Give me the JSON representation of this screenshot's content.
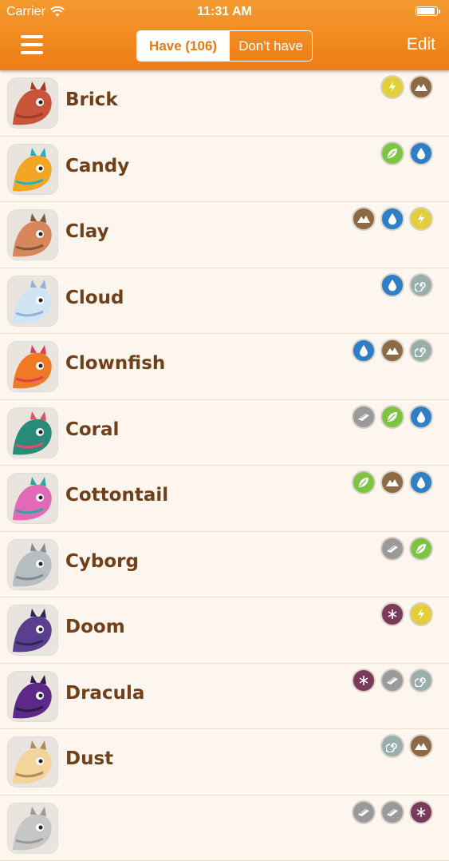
{
  "status": {
    "carrier": "Carrier",
    "time": "11:31 AM"
  },
  "nav": {
    "have_label": "Have (106)",
    "dont_have_label": "Don't have",
    "edit_label": "Edit"
  },
  "element_colors": {
    "lightning": "#e3cf3a",
    "earth": "#8c6a45",
    "nature": "#7cc442",
    "water": "#2f7fc6",
    "wind": "#9aaeac",
    "metal": "#9a9a9a",
    "dark": "#7a3a5a"
  },
  "dragons": [
    {
      "name": "Brick",
      "elements": [
        "lightning",
        "earth"
      ],
      "colors": [
        "#c8553a",
        "#a23a26"
      ]
    },
    {
      "name": "Candy",
      "elements": [
        "nature",
        "water"
      ],
      "colors": [
        "#f3a623",
        "#2ab0b8"
      ]
    },
    {
      "name": "Clay",
      "elements": [
        "earth",
        "water",
        "lightning"
      ],
      "colors": [
        "#d8865c",
        "#7f5a3a"
      ]
    },
    {
      "name": "Cloud",
      "elements": [
        "water",
        "wind"
      ],
      "colors": [
        "#cfe4f5",
        "#8fb6d6"
      ]
    },
    {
      "name": "Clownfish",
      "elements": [
        "water",
        "earth",
        "wind"
      ],
      "colors": [
        "#f07a24",
        "#e33b5c"
      ]
    },
    {
      "name": "Coral",
      "elements": [
        "metal",
        "nature",
        "water"
      ],
      "colors": [
        "#2a8b79",
        "#e24f6d"
      ]
    },
    {
      "name": "Cottontail",
      "elements": [
        "nature",
        "earth",
        "water"
      ],
      "colors": [
        "#e06ab8",
        "#2aa99a"
      ]
    },
    {
      "name": "Cyborg",
      "elements": [
        "metal",
        "nature"
      ],
      "colors": [
        "#b7bec2",
        "#7f8c93"
      ]
    },
    {
      "name": "Doom",
      "elements": [
        "dark",
        "lightning"
      ],
      "colors": [
        "#5b3f8f",
        "#2f2757"
      ]
    },
    {
      "name": "Dracula",
      "elements": [
        "dark",
        "metal",
        "wind"
      ],
      "colors": [
        "#5c2a86",
        "#2a1a44"
      ]
    },
    {
      "name": "Dust",
      "elements": [
        "wind",
        "earth"
      ],
      "colors": [
        "#f3d49a",
        "#b38a58"
      ]
    },
    {
      "name": "",
      "elements": [
        "metal",
        "metal",
        "dark"
      ],
      "colors": [
        "#c7c7c7",
        "#9a9a9a"
      ]
    }
  ]
}
